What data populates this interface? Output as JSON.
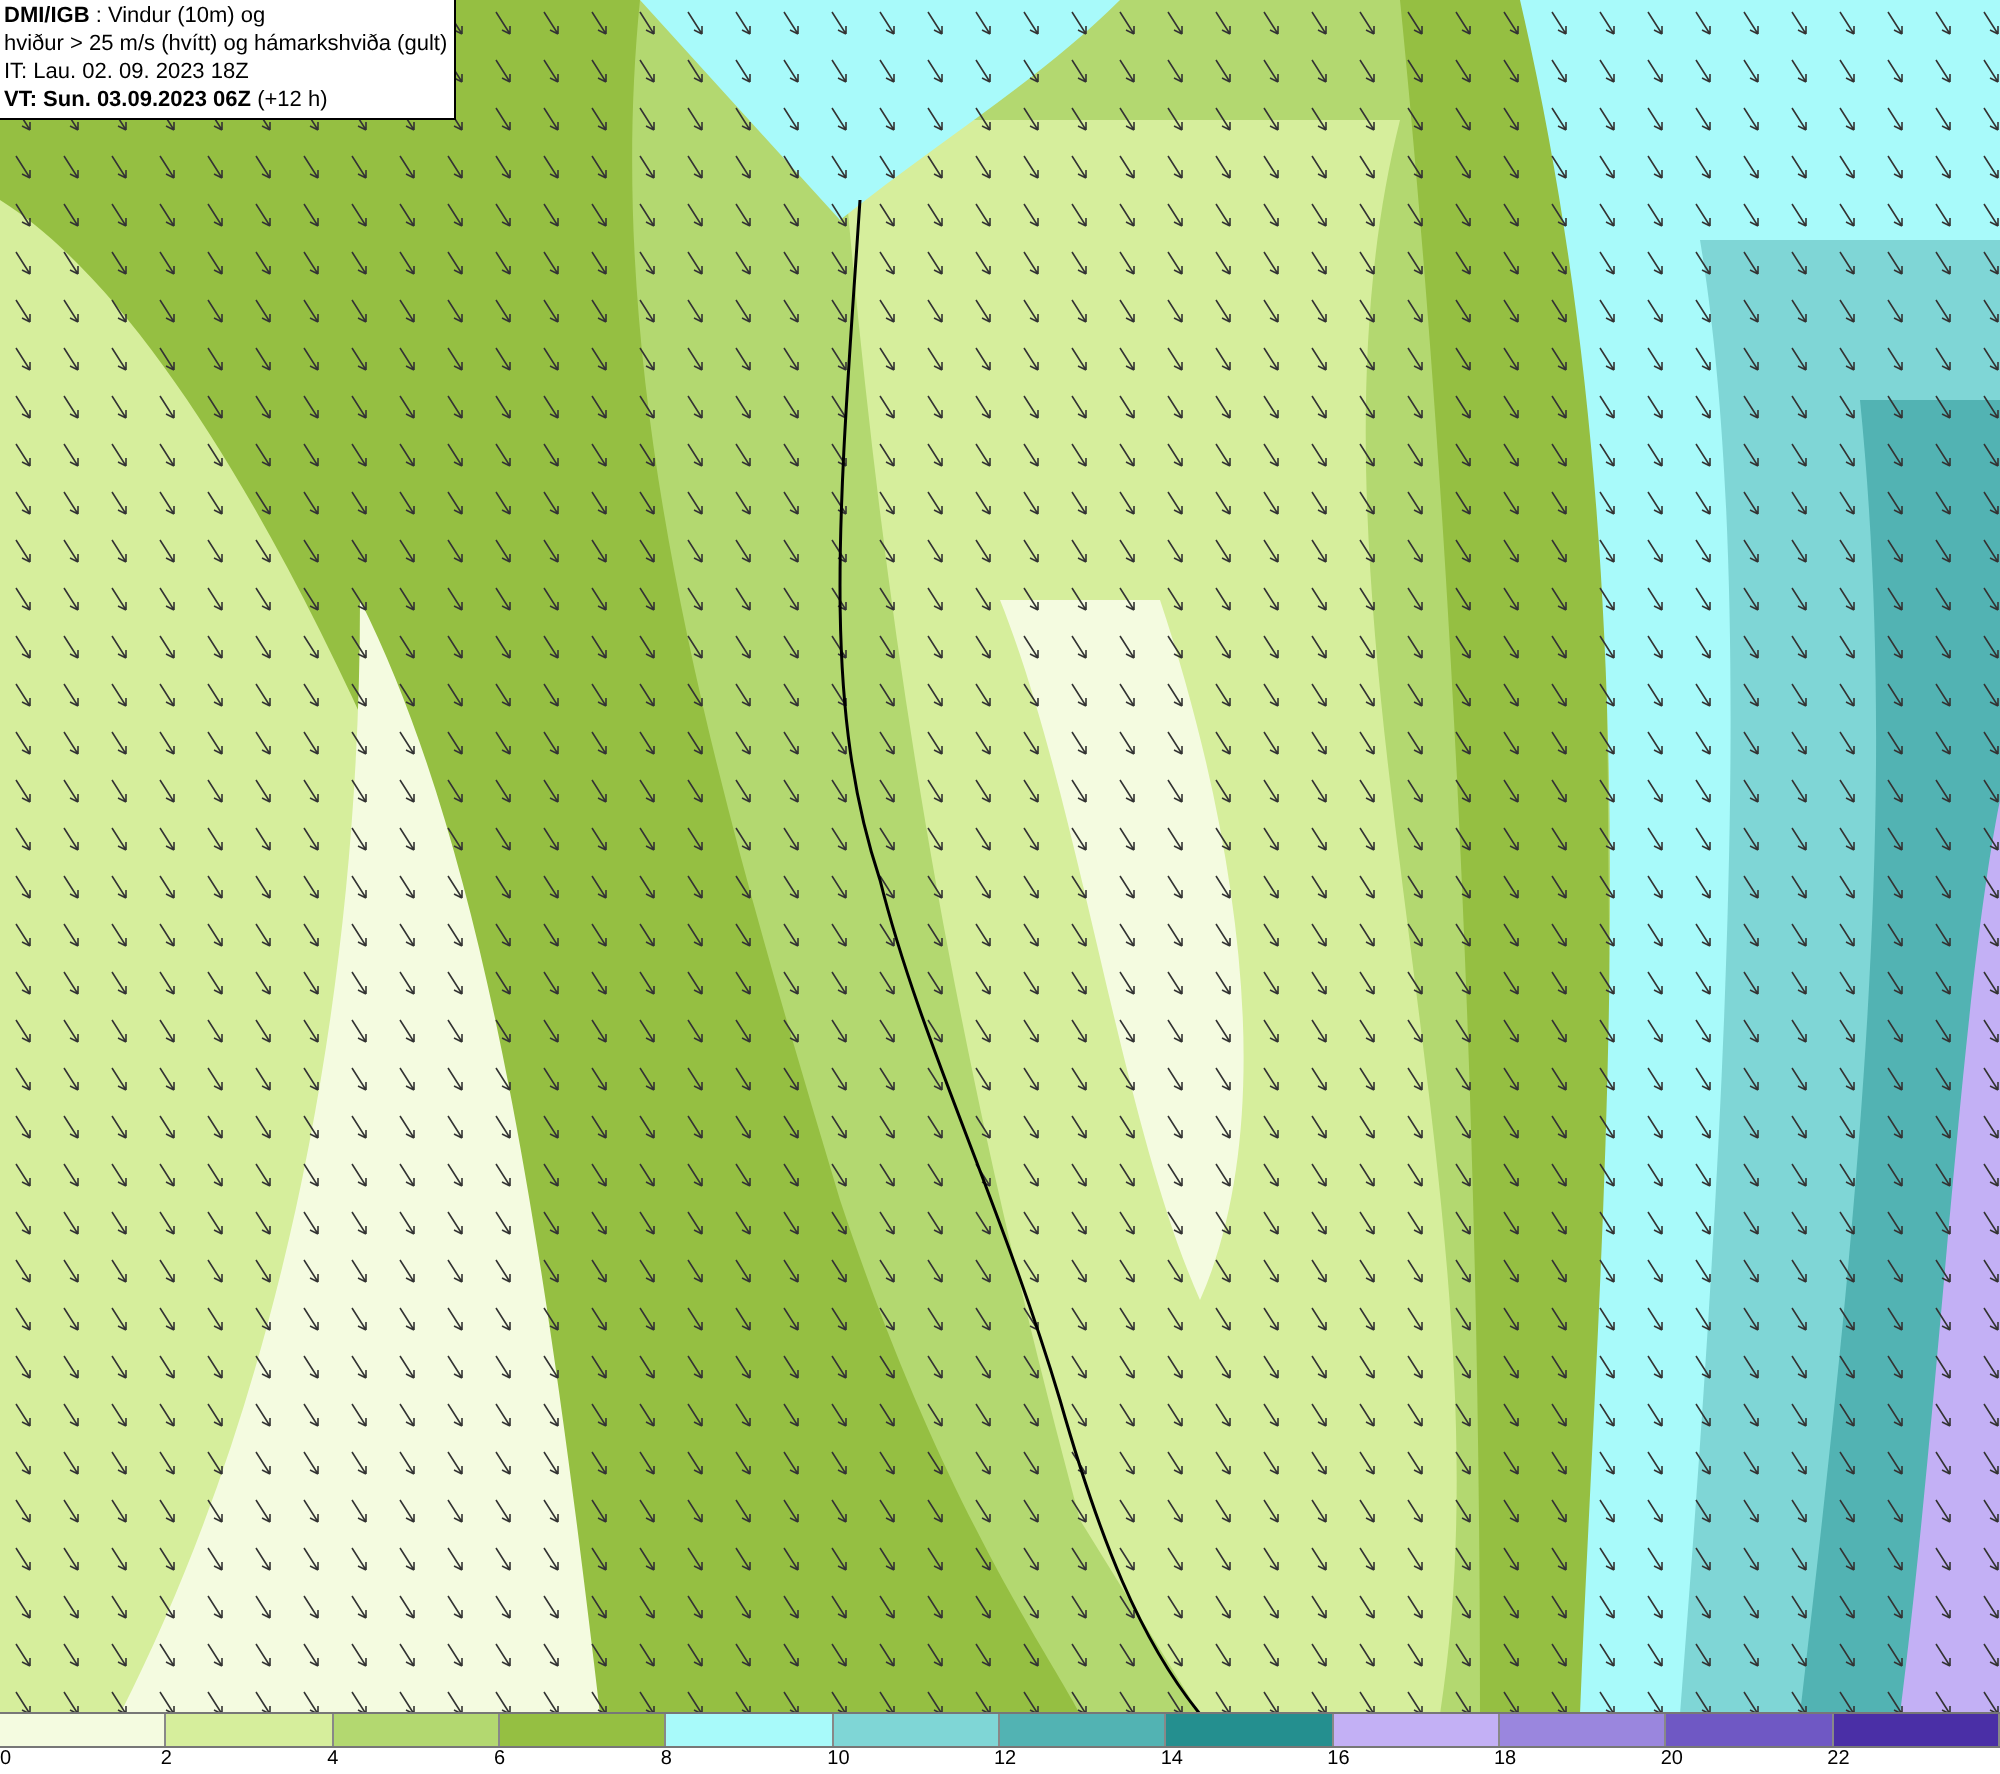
{
  "header": {
    "lines": [
      "**DMI/IGB** : Vindur (10m) og",
      "hviður > 25 m/s (hvítt) og hámarkshviða (gult)",
      "IT: Lau. 02. 09. 2023 18Z",
      "**VT: Sun. 03.09.2023 06Z** (+12 h)"
    ]
  },
  "legend": {
    "bins": [
      {
        "label": "0",
        "color": "#f4fbe0"
      },
      {
        "label": "2",
        "color": "#d6ee9c"
      },
      {
        "label": "4",
        "color": "#b3d870"
      },
      {
        "label": "6",
        "color": "#95bf42"
      },
      {
        "label": "8",
        "color": "#a8fafa"
      },
      {
        "label": "10",
        "color": "#7fd6d6"
      },
      {
        "label": "12",
        "color": "#52b3b3"
      },
      {
        "label": "14",
        "color": "#248f8f"
      },
      {
        "label": "16",
        "color": "#c3b0f5"
      },
      {
        "label": "18",
        "color": "#9a86de"
      },
      {
        "label": "20",
        "color": "#6f58c4"
      },
      {
        "label": "22",
        "color": "#4a2fa6"
      }
    ]
  }
}
